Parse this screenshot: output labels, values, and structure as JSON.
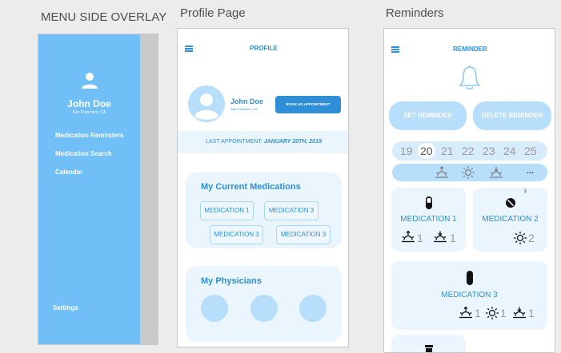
{
  "captions": {
    "menu": "MENU SIDE OVERLAY",
    "profile": "Profile Page",
    "reminders": "Reminders"
  },
  "menu": {
    "user_name": "John Doe",
    "user_location": "San Francisco, CA",
    "items": [
      "Medication Reminders",
      "Medication Search",
      "Calendar"
    ],
    "settings": "Settings"
  },
  "profile": {
    "title": "PROFILE",
    "user_name": "John Doe",
    "user_location": "San Francisco, CA",
    "book_button": "BOOK AN APPOINTMENT",
    "last_appointment_label": "LAST APPOINTMENT:",
    "last_appointment_date": "JANUARY 20TH, 2019",
    "medications_heading": "My Current Medications",
    "medications": [
      "MEDICATION 1",
      "MEDICATION 3",
      "MEDICATION 3",
      "MEDICATION 3"
    ],
    "physicians_heading": "My Physicians"
  },
  "reminder": {
    "title": "REMINDER",
    "set_button": "SET REMINDER",
    "delete_button": "DELETE REMINDER",
    "dates": [
      "19",
      "20",
      "21",
      "22",
      "23",
      "24",
      "25"
    ],
    "selected_date": "20",
    "more": "...",
    "meds": [
      {
        "name": "MEDICATION 1",
        "icons": [
          "sunrise-icon",
          "sunset-icon"
        ],
        "counts": [
          "1",
          "1"
        ]
      },
      {
        "name": "MEDICATION 2",
        "icons": [
          "sun-icon"
        ],
        "counts": [
          "2"
        ]
      },
      {
        "name": "MEDICATION 3",
        "icons": [
          "sunrise-icon",
          "sun-icon",
          "sunset-icon"
        ],
        "counts": [
          "1",
          "1",
          "1"
        ]
      }
    ]
  },
  "colors": {
    "menu_blue": "#70bff7",
    "accent_blue": "#2f8fd6",
    "light_blue": "#eaf5fd",
    "pill_blue": "#b7defa"
  }
}
